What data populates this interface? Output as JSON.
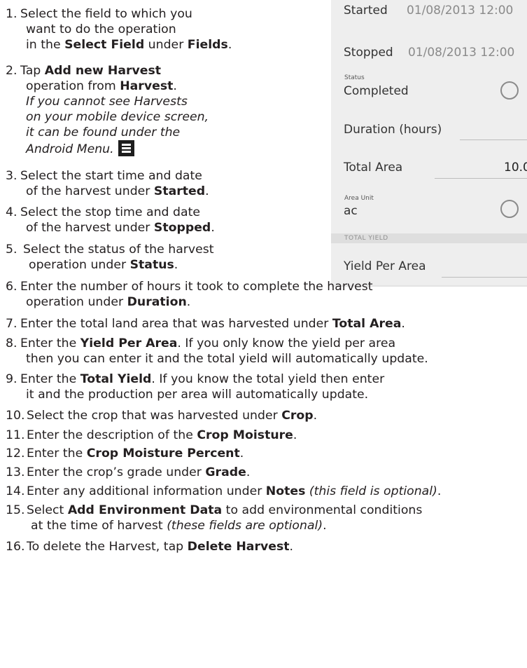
{
  "phone": {
    "started_label": "Started",
    "started_value": "01/08/2013 12:00",
    "stopped_label": "Stopped",
    "stopped_value": "01/08/2013 12:00",
    "status_caption": "Status",
    "status_value": "Completed",
    "duration_label": "Duration (hours)",
    "total_area_label": "Total Area",
    "total_area_value": "10.0",
    "area_unit_caption": "Area Unit",
    "area_unit_value": "ac",
    "total_yield_section": "TOTAL YIELD",
    "yield_per_area_label": "Yield Per Area"
  },
  "steps": [
    {
      "num": "1.",
      "l1a": "Select the field to which you",
      "l2a": "want to do the operation",
      "l3a": "in the ",
      "l3b": "Select Field",
      "l3c": " under ",
      "l3d": "Fields",
      "l3e": "."
    },
    {
      "num": "2.",
      "l1a": "Tap ",
      "l1b": "Add new Harvest",
      "l2a": "operation from ",
      "l2b": "Harvest",
      "l2c": ".",
      "l3": "If you cannot see Harvests",
      "l4": "on your mobile device screen,",
      "l5": "it can be found under the",
      "l6": "Android Menu."
    },
    {
      "num": "3.",
      "l1a": "Select the start time and date",
      "l2a": "of the harvest under ",
      "l2b": "Started",
      "l2c": "."
    },
    {
      "num": "4.",
      "l1a": "Select the stop time and date",
      "l2a": "of the harvest under ",
      "l2b": "Stopped",
      "l2c": "."
    },
    {
      "num": "5.",
      "l1a": "Select the status of the harvest",
      "l2a": "operation under ",
      "l2b": "Status",
      "l2c": "."
    },
    {
      "num": "6.",
      "l1a": "Enter the number of hours it took to complete the harvest",
      "l2a": "operation under ",
      "l2b": "Duration",
      "l2c": "."
    },
    {
      "num": "7.",
      "l1a": "Enter the total land area that was harvested under ",
      "l1b": "Total Area",
      "l1c": "."
    },
    {
      "num": "8.",
      "l1a": "Enter the ",
      "l1b": "Yield Per Area",
      "l1c": ". If you only know the yield per area",
      "l2a": "then you can enter it and the total yield will automatically update."
    },
    {
      "num": "9.",
      "l1a": "Enter the ",
      "l1b": "Total Yield",
      "l1c": ". If you know the total yield then enter",
      "l2a": "it and the production per area will automatically update."
    },
    {
      "num": "10.",
      "l1a": "Select the crop that was harvested under ",
      "l1b": "Crop",
      "l1c": "."
    },
    {
      "num": "11.",
      "l1a": "Enter the description of the ",
      "l1b": "Crop Moisture",
      "l1c": "."
    },
    {
      "num": "12.",
      "l1a": "Enter the ",
      "l1b": "Crop Moisture Percent",
      "l1c": "."
    },
    {
      "num": "13.",
      "l1a": "Enter the crop’s grade under ",
      "l1b": "Grade",
      "l1c": "."
    },
    {
      "num": "14.",
      "l1a": "Enter any additional information under ",
      "l1b": "Notes",
      "l1c": " ",
      "l1d": "(this field is optional)",
      "l1e": "."
    },
    {
      "num": "15.",
      "l1a": "Select ",
      "l1b": "Add Environment Data",
      "l1c": " to add environmental conditions",
      "l2a": "at the time of harvest ",
      "l2b": "(these fields are optional)",
      "l2c": "."
    },
    {
      "num": "16.",
      "l1a": "To delete the Harvest, tap ",
      "l1b": "Delete Harvest",
      "l1c": "."
    }
  ]
}
